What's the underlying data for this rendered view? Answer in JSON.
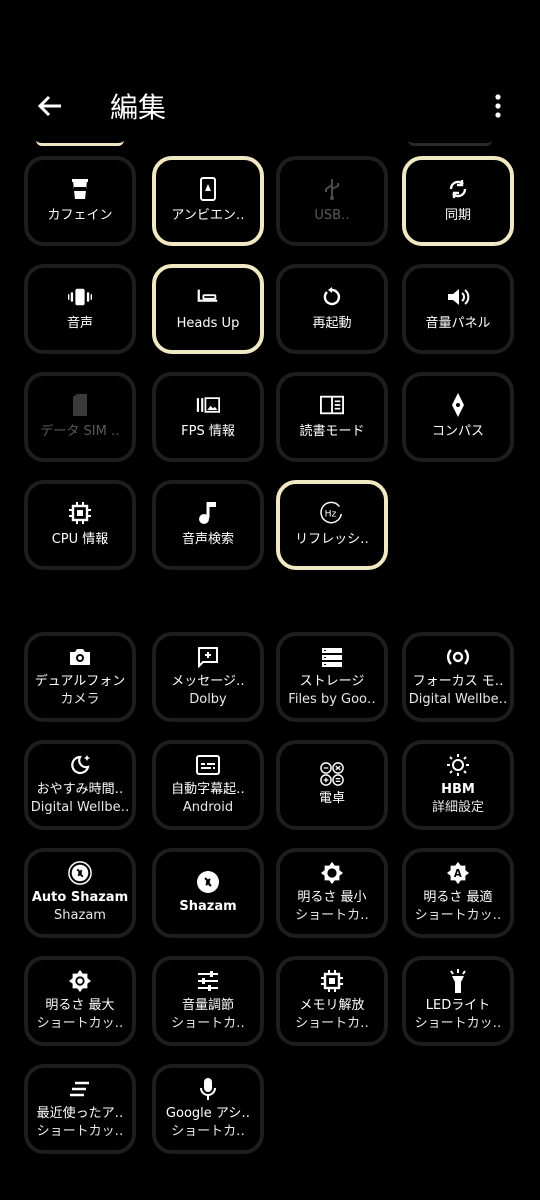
{
  "header": {
    "title": "編集",
    "back_icon": "arrow-back-icon",
    "more_icon": "more-vert-icon"
  },
  "colors": {
    "background": "#000000",
    "tile_border": "#1e1e1e",
    "selected_border": "#f1e8c4",
    "dim_text": "#5a5a5a"
  },
  "active_tiles": [
    {
      "label": "カフェイン",
      "icon": "coffee-cup-icon",
      "selected": false
    },
    {
      "label": "アンビエン‥",
      "icon": "ambient-display-icon",
      "selected": true
    },
    {
      "label": "USB‥",
      "icon": "usb-icon",
      "selected": false,
      "dimmed": true
    },
    {
      "label": "同期",
      "icon": "sync-icon",
      "selected": true
    },
    {
      "label": "音声",
      "icon": "vibrate-icon",
      "selected": false
    },
    {
      "label": "Heads Up",
      "icon": "heads-up-icon",
      "selected": true
    },
    {
      "label": "再起動",
      "icon": "restart-icon",
      "selected": false
    },
    {
      "label": "音量パネル",
      "icon": "volume-icon",
      "selected": false
    },
    {
      "label": "データ SIM ‥",
      "icon": "sim-card-icon",
      "selected": false,
      "dimmed": true
    },
    {
      "label": "FPS 情報",
      "icon": "fps-icon",
      "selected": false
    },
    {
      "label": "読書モード",
      "icon": "reading-mode-icon",
      "selected": false
    },
    {
      "label": "コンパス",
      "icon": "compass-icon",
      "selected": false
    },
    {
      "label": "CPU 情報",
      "icon": "cpu-icon",
      "selected": false
    },
    {
      "label": "音声検索",
      "icon": "music-note-icon",
      "selected": false
    },
    {
      "label": "リフレッシ‥",
      "icon": "refresh-rate-icon",
      "selected": true
    }
  ],
  "available_tiles": [
    {
      "label": "デュアルフォン",
      "sub": "カメラ",
      "icon": "camera-icon"
    },
    {
      "label": "メッセージ‥",
      "sub": "Dolby",
      "icon": "message-add-icon"
    },
    {
      "label": "ストレージ",
      "sub": "Files by Goo‥",
      "icon": "storage-icon"
    },
    {
      "label": "フォーカス モ‥",
      "sub": "Digital Wellbe‥",
      "icon": "focus-mode-icon"
    },
    {
      "label": "おやすみ時間‥",
      "sub": "Digital Wellbe‥",
      "icon": "bedtime-icon"
    },
    {
      "label": "自動字幕起‥",
      "sub": "Android",
      "icon": "captions-icon"
    },
    {
      "label": "電卓",
      "sub": "",
      "icon": "calculator-icon"
    },
    {
      "label": "HBM",
      "sub": "詳細設定",
      "icon": "brightness-icon"
    },
    {
      "label": "Auto Shazam",
      "sub": "Shazam",
      "icon": "shazam-auto-icon"
    },
    {
      "label": "Shazam",
      "sub": "",
      "icon": "shazam-icon"
    },
    {
      "label": "明るさ 最小",
      "sub": "ショートカ‥",
      "icon": "brightness-low-icon"
    },
    {
      "label": "明るさ 最適",
      "sub": "ショートカッ‥",
      "icon": "brightness-auto-icon"
    },
    {
      "label": "明るさ 最大",
      "sub": "ショートカッ‥",
      "icon": "brightness-high-icon"
    },
    {
      "label": "音量調節",
      "sub": "ショートカ‥",
      "icon": "sliders-icon"
    },
    {
      "label": "メモリ解放",
      "sub": "ショートカ‥",
      "icon": "memory-icon"
    },
    {
      "label": "LEDライト",
      "sub": "ショートカッ‥",
      "icon": "flashlight-icon"
    },
    {
      "label": "最近使ったア‥",
      "sub": "ショートカッ‥",
      "icon": "recent-apps-icon"
    },
    {
      "label": "Google アシ‥",
      "sub": "ショートカ‥",
      "icon": "mic-icon"
    }
  ]
}
